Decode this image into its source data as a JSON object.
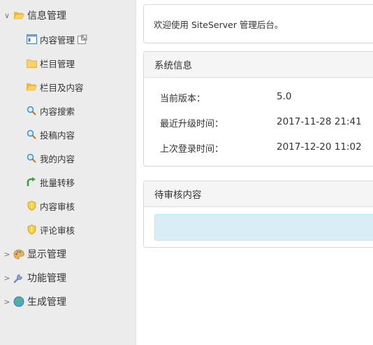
{
  "sidebar": {
    "info_mgmt": {
      "label": "信息管理",
      "caret": "∨"
    },
    "sub_items": [
      {
        "label": "内容管理"
      },
      {
        "label": "栏目管理"
      },
      {
        "label": "栏目及内容"
      },
      {
        "label": "内容搜索"
      },
      {
        "label": "投稿内容"
      },
      {
        "label": "我的内容"
      },
      {
        "label": "批量转移"
      },
      {
        "label": "内容审核"
      },
      {
        "label": "评论审核"
      }
    ],
    "display_mgmt": {
      "label": "显示管理",
      "caret": ">"
    },
    "function_mgmt": {
      "label": "功能管理",
      "caret": ">"
    },
    "generate_mgmt": {
      "label": "生成管理",
      "caret": ">"
    }
  },
  "welcome": {
    "text": "欢迎使用 SiteServer 管理后台。"
  },
  "system_info": {
    "title": "系统信息",
    "rows": [
      {
        "label": "当前版本：",
        "value": "5.0"
      },
      {
        "label": "最近升级时间：",
        "value": "2017-11-28 21:41"
      },
      {
        "label": "上次登录时间：",
        "value": "2017-12-20 11:02"
      }
    ]
  },
  "pending": {
    "title": "待审核内容"
  },
  "colors": {
    "sidebar_bg": "#ececec",
    "panel_head_bg": "#f5f5f5",
    "info_box_bg": "#d9edf7",
    "folder_yellow": "#f5c242",
    "search_blue": "#3a8fd8",
    "arrow_green": "#3aa63a",
    "shield_gold": "#e8b830"
  }
}
